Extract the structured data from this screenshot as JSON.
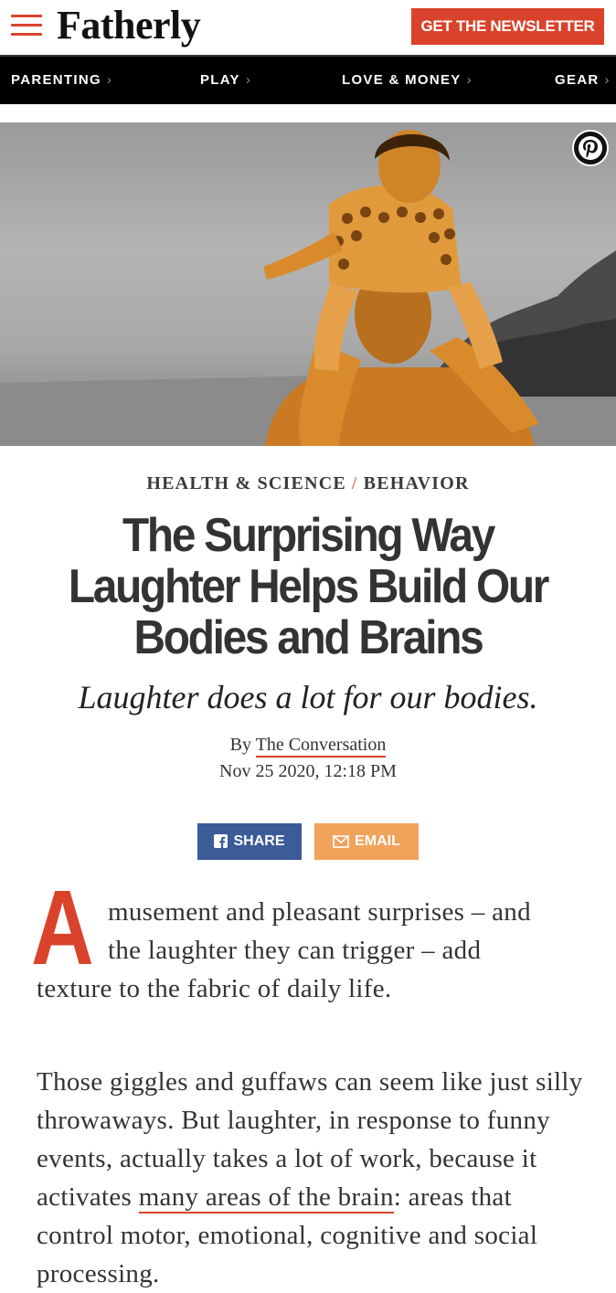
{
  "header": {
    "logo": "Fatherly",
    "newsletter_label": "GET THE NEWSLETTER"
  },
  "nav": {
    "items": [
      {
        "label": "PARENTING"
      },
      {
        "label": "PLAY"
      },
      {
        "label": "LOVE & MONEY"
      },
      {
        "label": "GEAR"
      }
    ],
    "chevron": "›"
  },
  "article": {
    "category": "HEALTH & SCIENCE",
    "category_sep": "/",
    "subcategory": "BEHAVIOR",
    "title": "The Surprising Way Laughter Helps Build Our Bodies and Brains",
    "dek": "Laughter does a lot for our bodies.",
    "byline_prefix": "By",
    "author": "The Conversation",
    "date": "Nov 25 2020, 12:18 PM",
    "share_label": "SHARE",
    "email_label": "EMAIL",
    "dropcap": "A",
    "p1_line1": "musement and pleasant surprises – and",
    "p1_line2": "the laughter they can trigger – add",
    "p1_line3": "texture to the fabric of daily life.",
    "p2_before": "Those giggles and guffaws can seem like just silly throwaways. But laughter, in response to funny events, actually takes a lot of work, because it activates ",
    "p2_link": "many areas of the brain",
    "p2_after": ": areas that control motor, emotional, cognitive and social processing."
  },
  "icons": {
    "menu": "hamburger-icon",
    "pinterest": "pinterest-icon",
    "facebook": "facebook-icon",
    "email": "envelope-icon"
  },
  "colors": {
    "brand_red": "#d9432c",
    "nav_bg": "#000000",
    "facebook_blue": "#3b5b99",
    "email_orange": "#f0a35b",
    "hero_tint": "#d98a2b"
  }
}
